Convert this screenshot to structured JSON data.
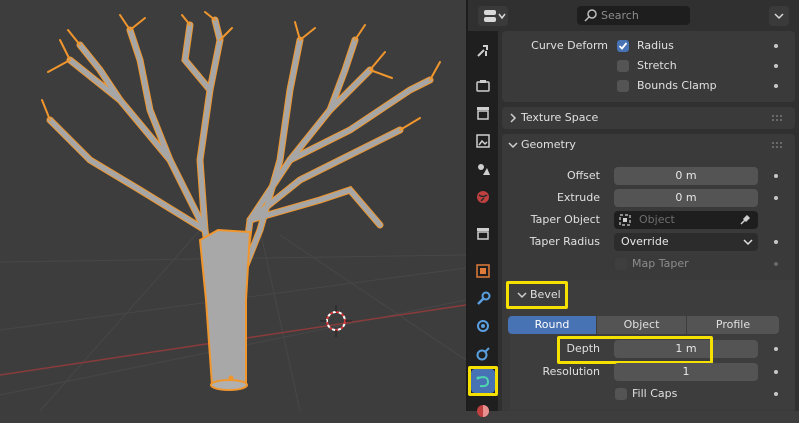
{
  "header": {
    "search_placeholder": "Search"
  },
  "colors": {
    "viewport_bg": "#3d3d3d",
    "tree_fill": "#a6a6a6",
    "selection_outline": "#f0962d",
    "accent_blue": "#4772b3",
    "highlight_yellow": "#f5e000"
  },
  "tabs": [
    {
      "name": "tool-icon"
    },
    {
      "name": "render-icon"
    },
    {
      "name": "output-icon"
    },
    {
      "name": "view-layer-icon"
    },
    {
      "name": "scene-icon"
    },
    {
      "name": "world-icon"
    },
    {
      "name": "collection-icon"
    },
    {
      "name": "object-icon"
    },
    {
      "name": "modifier-icon"
    },
    {
      "name": "particles-icon"
    },
    {
      "name": "physics-icon"
    },
    {
      "name": "curve-data-icon",
      "active": true
    },
    {
      "name": "material-icon"
    }
  ],
  "curve_deform": {
    "label": "Curve Deform",
    "radius": {
      "label": "Radius",
      "checked": true
    },
    "stretch": {
      "label": "Stretch",
      "checked": false
    },
    "bounds_clamp": {
      "label": "Bounds Clamp",
      "checked": false
    }
  },
  "texture_space": {
    "title": "Texture Space",
    "expanded": false
  },
  "geometry": {
    "title": "Geometry",
    "expanded": true,
    "offset": {
      "label": "Offset",
      "value": "0 m"
    },
    "extrude": {
      "label": "Extrude",
      "value": "0 m"
    },
    "taper_object": {
      "label": "Taper Object",
      "placeholder": "Object"
    },
    "taper_radius": {
      "label": "Taper Radius",
      "value": "Override"
    },
    "map_taper": {
      "label": "Map Taper",
      "checked": false,
      "enabled": false
    }
  },
  "bevel": {
    "title": "Bevel",
    "expanded": true,
    "modes": [
      "Round",
      "Object",
      "Profile"
    ],
    "selected_mode": "Round",
    "depth": {
      "label": "Depth",
      "value": "1 m"
    },
    "resolution": {
      "label": "Resolution",
      "value": "1"
    },
    "fill_caps": {
      "label": "Fill Caps",
      "checked": false
    }
  }
}
